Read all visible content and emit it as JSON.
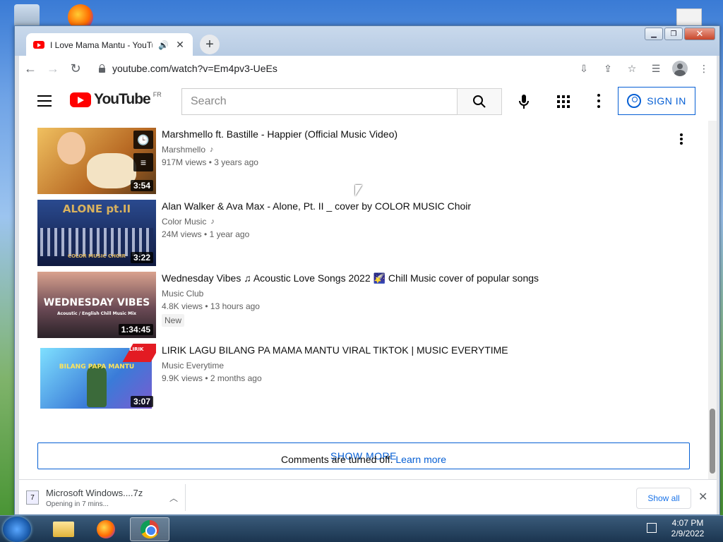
{
  "window": {
    "tab_title": "I Love Mama Mantu - YouTube",
    "url": "youtube.com/watch?v=Em4pv3-UeEs",
    "controls": [
      "minimize",
      "maximize",
      "close"
    ]
  },
  "youtube": {
    "logo_text": "YouTube",
    "logo_country": "FR",
    "search_placeholder": "Search",
    "signin_label": "SIGN IN"
  },
  "videos": [
    {
      "title": "Marshmello ft. Bastille - Happier (Official Music Video)",
      "channel": "Marshmello",
      "music_note": true,
      "views": "917M views",
      "age": "3 years ago",
      "duration": "3:54",
      "thumb_colors": [
        "#e0a64a",
        "#6b4a2b"
      ]
    },
    {
      "title": "Alan Walker & Ava Max - Alone, Pt. II _ cover by COLOR MUSIC Choir",
      "channel": "Color Music",
      "music_note": true,
      "views": "24M views",
      "age": "1 year ago",
      "duration": "3:22",
      "thumb_text": "ALONE pt.II",
      "thumb_subtext": "COLOR MUSIC CHOIR",
      "thumb_colors": [
        "#1d2f6b",
        "#0c1533"
      ]
    },
    {
      "title": "Wednesday Vibes ♫ Acoustic Love Songs 2022 🌠 Chill Music cover of popular songs",
      "channel": "Music Club",
      "music_note": false,
      "views": "4.8K views",
      "age": "13 hours ago",
      "badge": "New",
      "duration": "1:34:45",
      "thumb_text": "WEDNESDAY VIBES",
      "thumb_subtext": "Acoustic / English Chill Music Mix",
      "thumb_colors": [
        "#c98a7a",
        "#3b2b33"
      ]
    },
    {
      "title": "LIRIK LAGU BILANG PA MAMA MANTU VIRAL TIKTOK | MUSIC EVERYTIME",
      "channel": "Music Everytime",
      "music_note": false,
      "views": "9.9K views",
      "age": "2 months ago",
      "duration": "3:07",
      "thumb_text": "BILANG PAPA MANTU",
      "thumb_ribbon": "LIRIK",
      "thumb_colors": [
        "#5ec7f0",
        "#2d6ad6"
      ]
    }
  ],
  "show_more_label": "SHOW MORE",
  "comments": {
    "text": "Comments are turned off.",
    "link": "Learn more"
  },
  "download": {
    "file_name": "Microsoft Windows....7z",
    "status": "Opening in 7 mins...",
    "show_all_label": "Show all"
  },
  "taskbar": {
    "time": "4:07 PM",
    "date": "2/9/2022"
  }
}
